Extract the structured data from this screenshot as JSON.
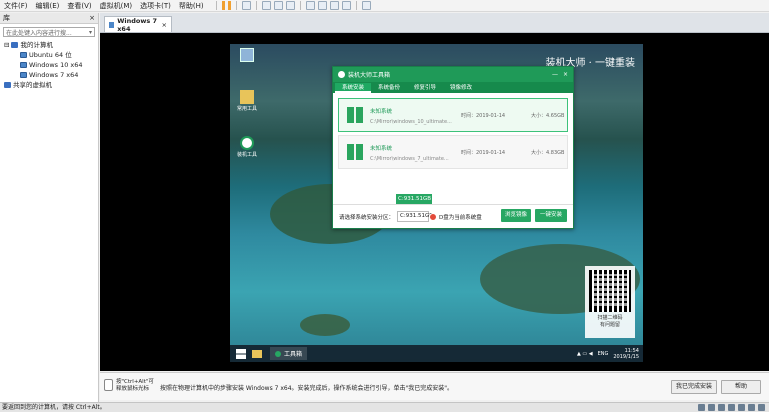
{
  "menubar": {
    "items": [
      "文件(F)",
      "编辑(E)",
      "查看(V)",
      "虚拟机(M)",
      "选项卡(T)",
      "帮助(H)"
    ]
  },
  "library": {
    "title": "库",
    "close": "×",
    "search_placeholder": "在此处键入内容进行搜...",
    "tree": {
      "root": "我的计算机",
      "vms": [
        "Ubuntu 64 位",
        "Windows 10 x64",
        "Windows 7 x64"
      ],
      "shared": "共享的虚拟机"
    }
  },
  "vm_tab": {
    "label": "Windows 7 x64",
    "close": "×"
  },
  "guest": {
    "brand": "装机大师 · 一键重装",
    "desktop_icons": [
      "",
      "常用工具",
      "装机工具"
    ],
    "installer": {
      "title": "装机大师工具箱",
      "tabs": [
        "系统安装",
        "系统备份",
        "修复引导",
        "镜像修改"
      ],
      "systems": [
        {
          "name": "未知系统",
          "path": "C:\\Mirror\\windows_10_ultimate...",
          "time": "时间：2019-01-14",
          "size": "大小：4.65GB"
        },
        {
          "name": "未知系统",
          "path": "C:\\Mirror\\windows_7_ultimate...",
          "time": "时间：2019-01-14",
          "size": "大小：4.83GB"
        }
      ],
      "footer": {
        "label": "请选择系统安装分区：",
        "selected": "C:931.51GB",
        "dropdown_option": "C:931.51GB",
        "note": "D盘为当前系统盘",
        "browse": "浏览镜像",
        "install": "一键安装"
      }
    },
    "qr_caption_1": "扫描二维码",
    "qr_caption_2": "有问题留",
    "taskbar": {
      "app": "工具箱",
      "lang": "ENG",
      "time": "11:54",
      "date": "2019/1/15"
    }
  },
  "hint": {
    "key_text": "按\"Ctrl+Alt\"可释放鼠标光标",
    "message": "按照在物理计算机中的步骤安装 Windows 7 x64。安装完成后，操作系统会进行引导，单击\"我已完成安装\"。",
    "done_button": "我已完成安装",
    "help_button": "帮助"
  },
  "status": {
    "text": "要返回到您的计算机，请按 Ctrl+Alt。"
  }
}
